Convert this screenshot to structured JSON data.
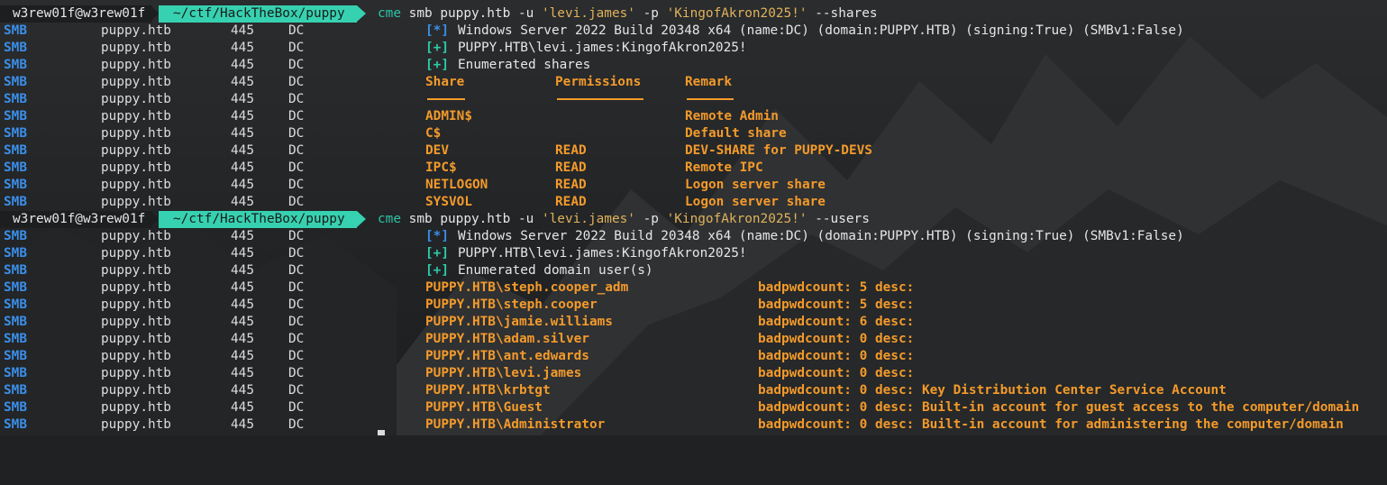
{
  "prompt": {
    "user": "w3rew01f@w3rew01f",
    "path": "~/ctf/HackTheBox/puppy"
  },
  "row_cols": {
    "proto": "SMB",
    "host": "puppy.htb",
    "port": "445",
    "name": "DC"
  },
  "commands": [
    {
      "tool": "cme",
      "args": "smb puppy.htb -u ",
      "user": "'levi.james'",
      "pflag": " -p ",
      "pass": "'KingofAkron2025!'",
      "opt": " --shares"
    },
    {
      "tool": "cme",
      "args": "smb puppy.htb -u ",
      "user": "'levi.james'",
      "pflag": " -p ",
      "pass": "'KingofAkron2025!'",
      "opt": " --users"
    }
  ],
  "shares_output": {
    "info": {
      "tag": "[*]",
      "text": "Windows Server 2022 Build 20348 x64 (name:DC) (domain:PUPPY.HTB) (signing:True) (SMBv1:False)"
    },
    "auth": {
      "tag": "[+]",
      "text": "PUPPY.HTB\\levi.james:KingofAkron2025!"
    },
    "enum": {
      "tag": "[+]",
      "text": "Enumerated shares"
    },
    "headers": {
      "share": "Share",
      "perm": "Permissions",
      "remark": "Remark"
    },
    "rows": [
      {
        "share": "ADMIN$",
        "perm": "",
        "remark": "Remote Admin"
      },
      {
        "share": "C$",
        "perm": "",
        "remark": "Default share"
      },
      {
        "share": "DEV",
        "perm": "READ",
        "remark": "DEV-SHARE for PUPPY-DEVS"
      },
      {
        "share": "IPC$",
        "perm": "READ",
        "remark": "Remote IPC"
      },
      {
        "share": "NETLOGON",
        "perm": "READ",
        "remark": "Logon server share"
      },
      {
        "share": "SYSVOL",
        "perm": "READ",
        "remark": "Logon server share"
      }
    ]
  },
  "users_output": {
    "info": {
      "tag": "[*]",
      "text": "Windows Server 2022 Build 20348 x64 (name:DC) (domain:PUPPY.HTB) (signing:True) (SMBv1:False)"
    },
    "auth": {
      "tag": "[+]",
      "text": "PUPPY.HTB\\levi.james:KingofAkron2025!"
    },
    "enum": {
      "tag": "[+]",
      "text": "Enumerated domain user(s)"
    },
    "rows": [
      {
        "user": "PUPPY.HTB\\steph.cooper_adm",
        "info": "badpwdcount: 5 desc:"
      },
      {
        "user": "PUPPY.HTB\\steph.cooper",
        "info": "badpwdcount: 5 desc:"
      },
      {
        "user": "PUPPY.HTB\\jamie.williams",
        "info": "badpwdcount: 6 desc:"
      },
      {
        "user": "PUPPY.HTB\\adam.silver",
        "info": "badpwdcount: 0 desc:"
      },
      {
        "user": "PUPPY.HTB\\ant.edwards",
        "info": "badpwdcount: 0 desc:"
      },
      {
        "user": "PUPPY.HTB\\levi.james",
        "info": "badpwdcount: 0 desc:"
      },
      {
        "user": "PUPPY.HTB\\krbtgt",
        "info": "badpwdcount: 0 desc: Key Distribution Center Service Account"
      },
      {
        "user": "PUPPY.HTB\\Guest",
        "info": "badpwdcount: 0 desc: Built-in account for guest access to the computer/domain"
      },
      {
        "user": "PUPPY.HTB\\Administrator",
        "info": "badpwdcount: 0 desc: Built-in account for administering the computer/domain"
      }
    ]
  },
  "colors": {
    "smb": "#3b8ee8",
    "accent": "#36d1b0",
    "highlight": "#f39a2b",
    "background": "#1f2123"
  }
}
